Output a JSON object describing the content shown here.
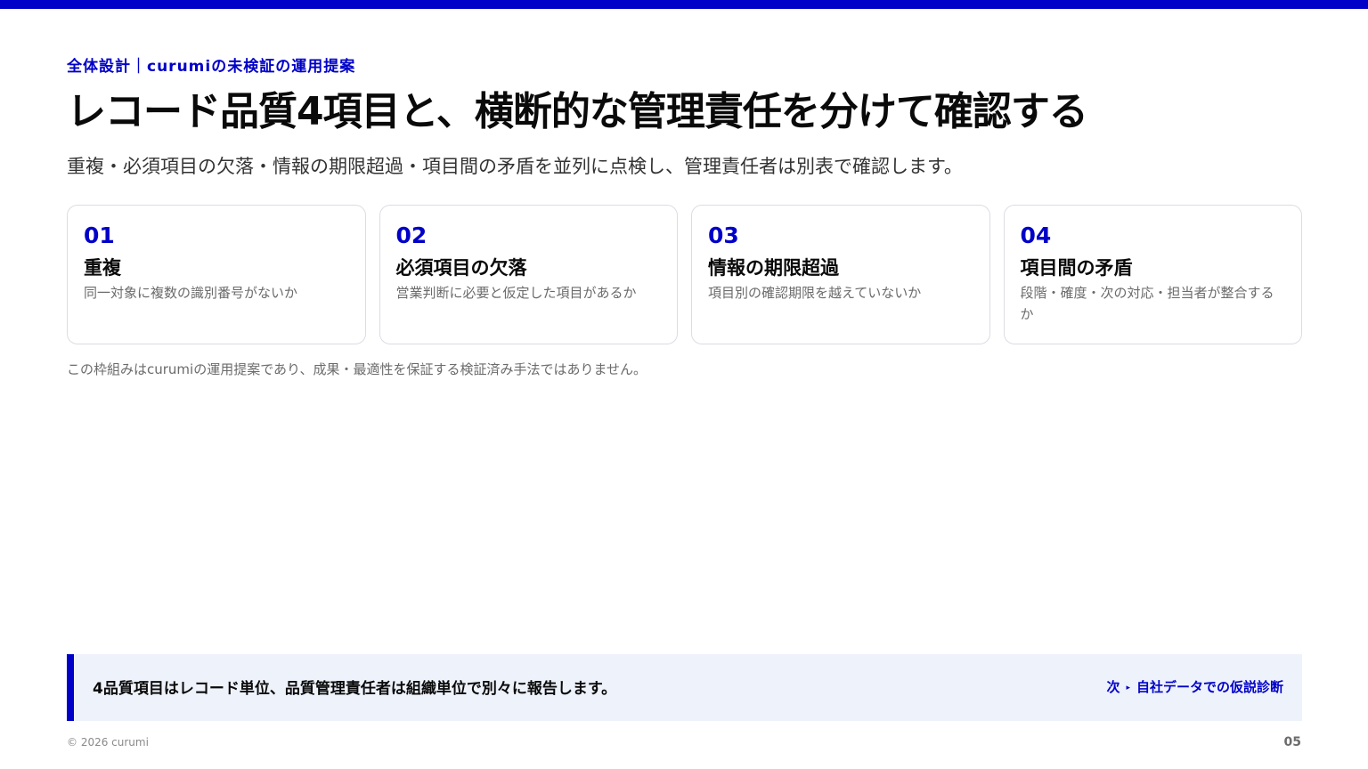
{
  "header": {
    "eyebrow": "全体設計｜curumiの未検証の運用提案",
    "title": "レコード品質4項目と、横断的な管理責任を分けて確認する",
    "subtitle": "重複・必須項目の欠落・情報の期限超過・項目間の矛盾を並列に点検し、管理責任者は別表で確認します。"
  },
  "cards": [
    {
      "number": "01",
      "title": "重複",
      "description": "同一対象に複数の識別番号がないか"
    },
    {
      "number": "02",
      "title": "必須項目の欠落",
      "description": "営業判断に必要と仮定した項目があるか"
    },
    {
      "number": "03",
      "title": "情報の期限超過",
      "description": "項目別の確認期限を越えていないか"
    },
    {
      "number": "04",
      "title": "項目間の矛盾",
      "description": "段階・確度・次の対応・担当者が整合するか"
    }
  ],
  "footnote": "この枠組みはcurumiの運用提案であり、成果・最適性を保証する検証済み手法ではありません。",
  "callout": {
    "text": "4品質項目はレコード単位、品質管理責任者は組織単位で別々に報告します。",
    "next_prefix": "次",
    "next_arrow": "▸",
    "next_label": "自社データでの仮説診断"
  },
  "footer": {
    "copyright": "© 2026 curumi",
    "page": "05"
  },
  "colors": {
    "accent": "#0000c8",
    "callout_bg": "#eef2fb",
    "card_border": "#dcdce4"
  }
}
